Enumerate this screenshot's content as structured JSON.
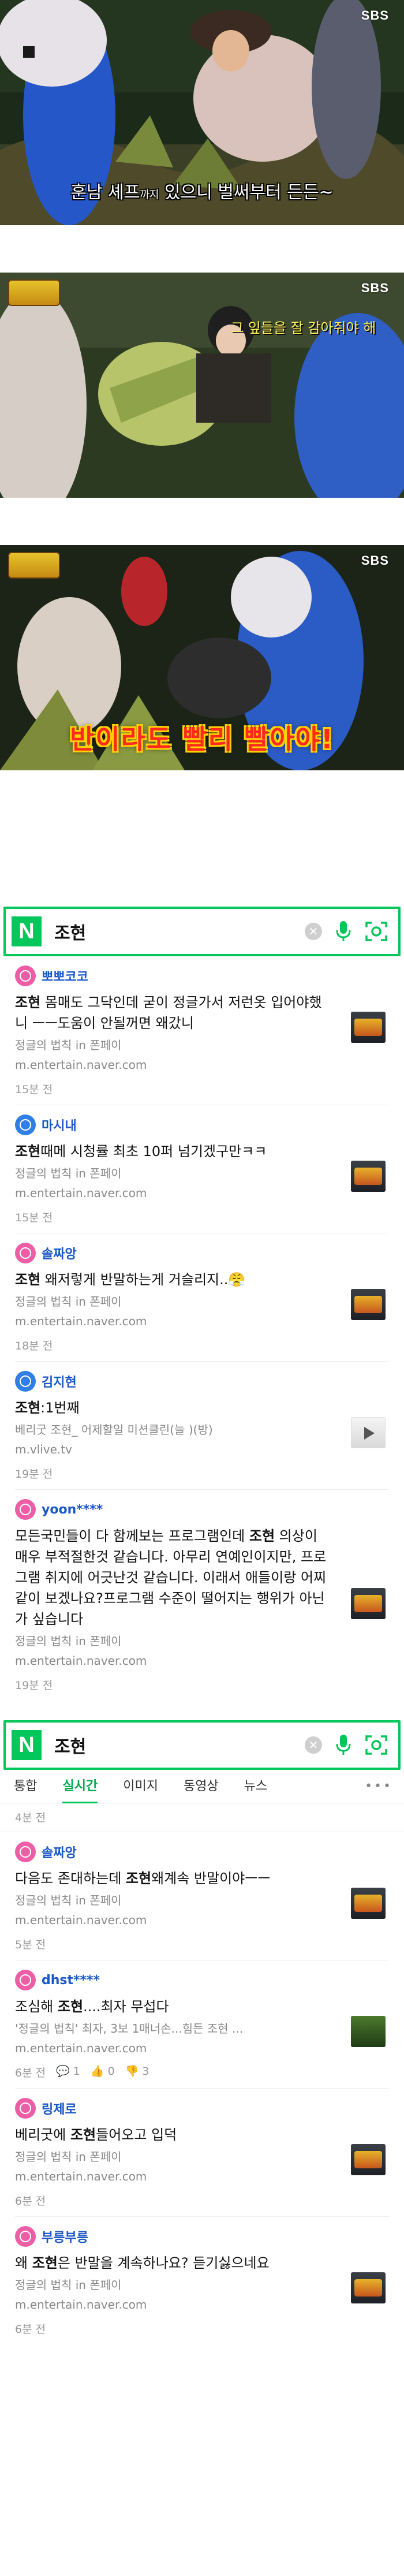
{
  "frame1": {
    "channel": "SBS",
    "caption_a": "훈남 셰프",
    "caption_small": "까지",
    "caption_b": " 있으니 벌써부터 든든~"
  },
  "frame2": {
    "channel": "SBS",
    "caption": "그 잎들을 잘 감아줘야 해"
  },
  "frame3": {
    "channel": "SBS",
    "caption": "반이라도 빨리 빨아야!"
  },
  "search1": {
    "query": "조현",
    "posts": [
      {
        "author": "뽀뽀코코",
        "text_pre": "",
        "text_bold": "조현",
        "text_post": " 몸매도 그닥인데 굳이 정글가서 저런옷 입어야했니 ㅡㅡ도움이 안될꺼면 왜갔니",
        "source": "정글의 법칙 in 폰페이",
        "url": "m.entertain.naver.com",
        "time": "15분 전",
        "avatar": "pink",
        "thumb": "a"
      },
      {
        "author": "마시내",
        "text_pre": "",
        "text_bold": "조현",
        "text_post": "때메 시청률 최초 10퍼 넘기겠구만ㅋㅋ",
        "source": "정글의 법칙 in 폰페이",
        "url": "m.entertain.naver.com",
        "time": "15분 전",
        "avatar": "blue",
        "thumb": "a"
      },
      {
        "author": "솔짜앙",
        "text_pre": "",
        "text_bold": "조현",
        "text_post": " 왜저렇게 반말하는게 거슬리지..😤",
        "source": "정글의 법칙 in 폰페이",
        "url": "m.entertain.naver.com",
        "time": "18분 전",
        "avatar": "pink",
        "thumb": "a"
      },
      {
        "author": "김지현",
        "text_pre": "",
        "text_bold": "조현",
        "text_post": ":1번째",
        "source": "베리굿 조현_ 어제할일 미션클린(늘 )(방)",
        "url": "m.vlive.tv",
        "time": "19분 전",
        "avatar": "blue",
        "thumb": "v"
      },
      {
        "author": "yoon****",
        "text_pre": "모든국민들이 다 함께보는 프로그램인데 ",
        "text_bold": "조현",
        "text_post": " 의상이 매우 부적절한것 같습니다. 아무리 연예인이지만, 프로그램 취지에 어긋난것 같습니다. 이래서 애들이랑 어찌 같이 보겠나요?프로그램 수준이 떨어지는 행위가 아닌가 싶습니다",
        "source": "정글의 법칙 in 폰페이",
        "url": "m.entertain.naver.com",
        "time": "19분 전",
        "avatar": "pink",
        "thumb": "a"
      }
    ]
  },
  "search2": {
    "query": "조현",
    "tabs": [
      "통합",
      "실시간",
      "이미지",
      "동영상",
      "뉴스"
    ],
    "more": "•••",
    "top_time": "4분 전",
    "posts": [
      {
        "author": "솔짜앙",
        "text_pre": "다음도 존대하는데 ",
        "text_bold": "조현",
        "text_post": "왜계속 반말이야ㅡㅡ",
        "source": "정글의 법칙 in 폰페이",
        "url": "m.entertain.naver.com",
        "time": "5분 전",
        "avatar": "pink",
        "thumb": "a"
      },
      {
        "author": "dhst****",
        "text_pre": "조심해 ",
        "text_bold": "조현",
        "text_post": "....최자 무섭다",
        "source": "'정글의 법칙' 최자, 3보 1매너손...힘든 조현 ...",
        "url": "m.entertain.naver.com",
        "time": "6분 전",
        "avatar": "pink",
        "thumb": "g",
        "reply": "1",
        "like": "0",
        "dislike": "3"
      },
      {
        "author": "링제로",
        "text_pre": "베리굿에 ",
        "text_bold": "조현",
        "text_post": "들어오고 입덕",
        "source": "정글의 법칙 in 폰페이",
        "url": "m.entertain.naver.com",
        "time": "6분 전",
        "avatar": "pink",
        "thumb": "a"
      },
      {
        "author": "부릉부릉",
        "text_pre": "왜 ",
        "text_bold": "조현",
        "text_post": "은 반말을 계속하나요? 듣기싫으네요",
        "source": "정글의 법칙 in 폰페이",
        "url": "m.entertain.naver.com",
        "time": "6분 전",
        "avatar": "pink",
        "thumb": "a"
      }
    ]
  }
}
